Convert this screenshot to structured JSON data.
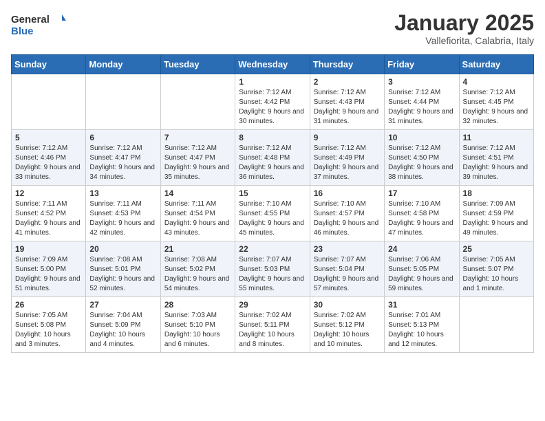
{
  "logo": {
    "general": "General",
    "blue": "Blue"
  },
  "title": "January 2025",
  "subtitle": "Vallefiorita, Calabria, Italy",
  "weekdays": [
    "Sunday",
    "Monday",
    "Tuesday",
    "Wednesday",
    "Thursday",
    "Friday",
    "Saturday"
  ],
  "weeks": [
    [
      null,
      null,
      null,
      {
        "day": 1,
        "sunrise": "7:12 AM",
        "sunset": "4:42 PM",
        "daylight": "9 hours and 30 minutes."
      },
      {
        "day": 2,
        "sunrise": "7:12 AM",
        "sunset": "4:43 PM",
        "daylight": "9 hours and 31 minutes."
      },
      {
        "day": 3,
        "sunrise": "7:12 AM",
        "sunset": "4:44 PM",
        "daylight": "9 hours and 31 minutes."
      },
      {
        "day": 4,
        "sunrise": "7:12 AM",
        "sunset": "4:45 PM",
        "daylight": "9 hours and 32 minutes."
      }
    ],
    [
      {
        "day": 5,
        "sunrise": "7:12 AM",
        "sunset": "4:46 PM",
        "daylight": "9 hours and 33 minutes."
      },
      {
        "day": 6,
        "sunrise": "7:12 AM",
        "sunset": "4:47 PM",
        "daylight": "9 hours and 34 minutes."
      },
      {
        "day": 7,
        "sunrise": "7:12 AM",
        "sunset": "4:47 PM",
        "daylight": "9 hours and 35 minutes."
      },
      {
        "day": 8,
        "sunrise": "7:12 AM",
        "sunset": "4:48 PM",
        "daylight": "9 hours and 36 minutes."
      },
      {
        "day": 9,
        "sunrise": "7:12 AM",
        "sunset": "4:49 PM",
        "daylight": "9 hours and 37 minutes."
      },
      {
        "day": 10,
        "sunrise": "7:12 AM",
        "sunset": "4:50 PM",
        "daylight": "9 hours and 38 minutes."
      },
      {
        "day": 11,
        "sunrise": "7:12 AM",
        "sunset": "4:51 PM",
        "daylight": "9 hours and 39 minutes."
      }
    ],
    [
      {
        "day": 12,
        "sunrise": "7:11 AM",
        "sunset": "4:52 PM",
        "daylight": "9 hours and 41 minutes."
      },
      {
        "day": 13,
        "sunrise": "7:11 AM",
        "sunset": "4:53 PM",
        "daylight": "9 hours and 42 minutes."
      },
      {
        "day": 14,
        "sunrise": "7:11 AM",
        "sunset": "4:54 PM",
        "daylight": "9 hours and 43 minutes."
      },
      {
        "day": 15,
        "sunrise": "7:10 AM",
        "sunset": "4:55 PM",
        "daylight": "9 hours and 45 minutes."
      },
      {
        "day": 16,
        "sunrise": "7:10 AM",
        "sunset": "4:57 PM",
        "daylight": "9 hours and 46 minutes."
      },
      {
        "day": 17,
        "sunrise": "7:10 AM",
        "sunset": "4:58 PM",
        "daylight": "9 hours and 47 minutes."
      },
      {
        "day": 18,
        "sunrise": "7:09 AM",
        "sunset": "4:59 PM",
        "daylight": "9 hours and 49 minutes."
      }
    ],
    [
      {
        "day": 19,
        "sunrise": "7:09 AM",
        "sunset": "5:00 PM",
        "daylight": "9 hours and 51 minutes."
      },
      {
        "day": 20,
        "sunrise": "7:08 AM",
        "sunset": "5:01 PM",
        "daylight": "9 hours and 52 minutes."
      },
      {
        "day": 21,
        "sunrise": "7:08 AM",
        "sunset": "5:02 PM",
        "daylight": "9 hours and 54 minutes."
      },
      {
        "day": 22,
        "sunrise": "7:07 AM",
        "sunset": "5:03 PM",
        "daylight": "9 hours and 55 minutes."
      },
      {
        "day": 23,
        "sunrise": "7:07 AM",
        "sunset": "5:04 PM",
        "daylight": "9 hours and 57 minutes."
      },
      {
        "day": 24,
        "sunrise": "7:06 AM",
        "sunset": "5:05 PM",
        "daylight": "9 hours and 59 minutes."
      },
      {
        "day": 25,
        "sunrise": "7:05 AM",
        "sunset": "5:07 PM",
        "daylight": "10 hours and 1 minute."
      }
    ],
    [
      {
        "day": 26,
        "sunrise": "7:05 AM",
        "sunset": "5:08 PM",
        "daylight": "10 hours and 3 minutes."
      },
      {
        "day": 27,
        "sunrise": "7:04 AM",
        "sunset": "5:09 PM",
        "daylight": "10 hours and 4 minutes."
      },
      {
        "day": 28,
        "sunrise": "7:03 AM",
        "sunset": "5:10 PM",
        "daylight": "10 hours and 6 minutes."
      },
      {
        "day": 29,
        "sunrise": "7:02 AM",
        "sunset": "5:11 PM",
        "daylight": "10 hours and 8 minutes."
      },
      {
        "day": 30,
        "sunrise": "7:02 AM",
        "sunset": "5:12 PM",
        "daylight": "10 hours and 10 minutes."
      },
      {
        "day": 31,
        "sunrise": "7:01 AM",
        "sunset": "5:13 PM",
        "daylight": "10 hours and 12 minutes."
      },
      null
    ]
  ]
}
